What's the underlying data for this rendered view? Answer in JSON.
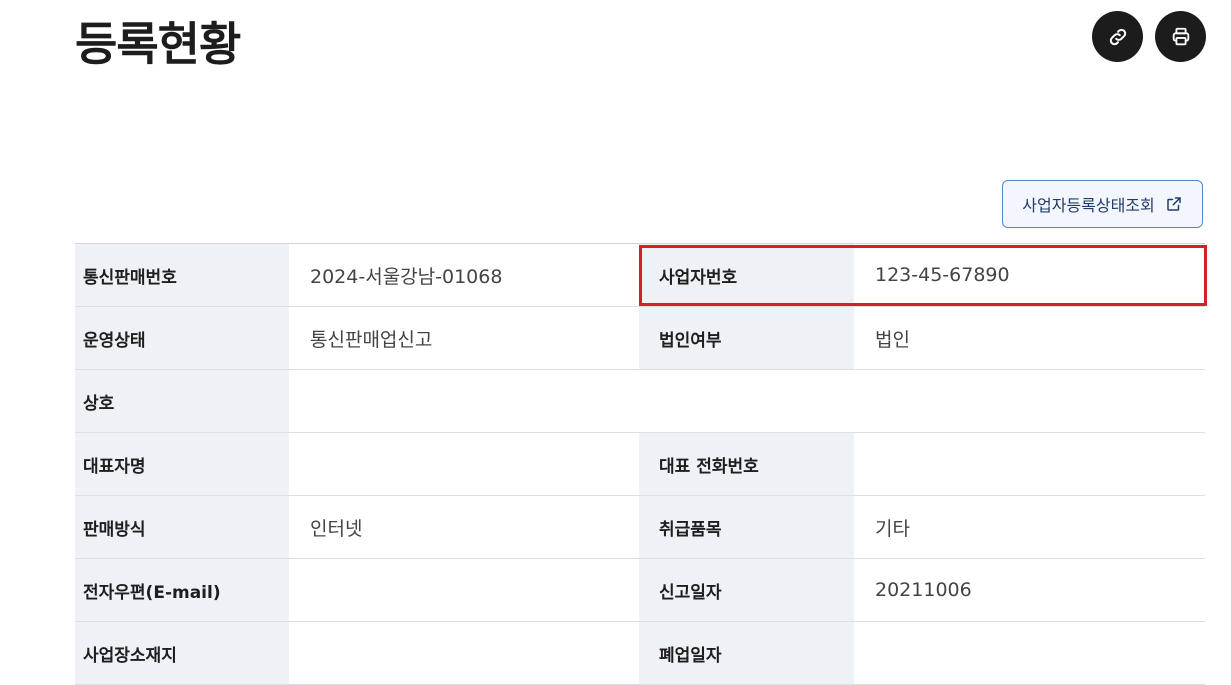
{
  "header": {
    "title": "등록현황",
    "link_icon": "link-icon",
    "print_icon": "print-icon"
  },
  "status_button": {
    "label": "사업자등록상태조회",
    "icon": "external-link-icon"
  },
  "colors": {
    "highlight_border": "#d2212b",
    "header_cell_bg": "#eef1f6",
    "button_border": "#5b86c2"
  },
  "table": {
    "rows": [
      {
        "label1": "통신판매번호",
        "value1": "2024-서울강남-01068",
        "label2": "사업자번호",
        "value2": "123-45-67890"
      },
      {
        "label1": "운영상태",
        "value1": "통신판매업신고",
        "label2": "법인여부",
        "value2": "법인"
      },
      {
        "label1": "상호",
        "value1": ""
      },
      {
        "label1": "대표자명",
        "value1": "",
        "label2": "대표 전화번호",
        "value2": ""
      },
      {
        "label1": "판매방식",
        "value1": "인터넷",
        "label2": "취급품목",
        "value2": "기타"
      },
      {
        "label1": "전자우편(E-mail)",
        "value1": "",
        "label2": "신고일자",
        "value2": "20211006"
      },
      {
        "label1": "사업장소재지",
        "value1": "",
        "label2": "폐업일자",
        "value2": ""
      }
    ]
  }
}
